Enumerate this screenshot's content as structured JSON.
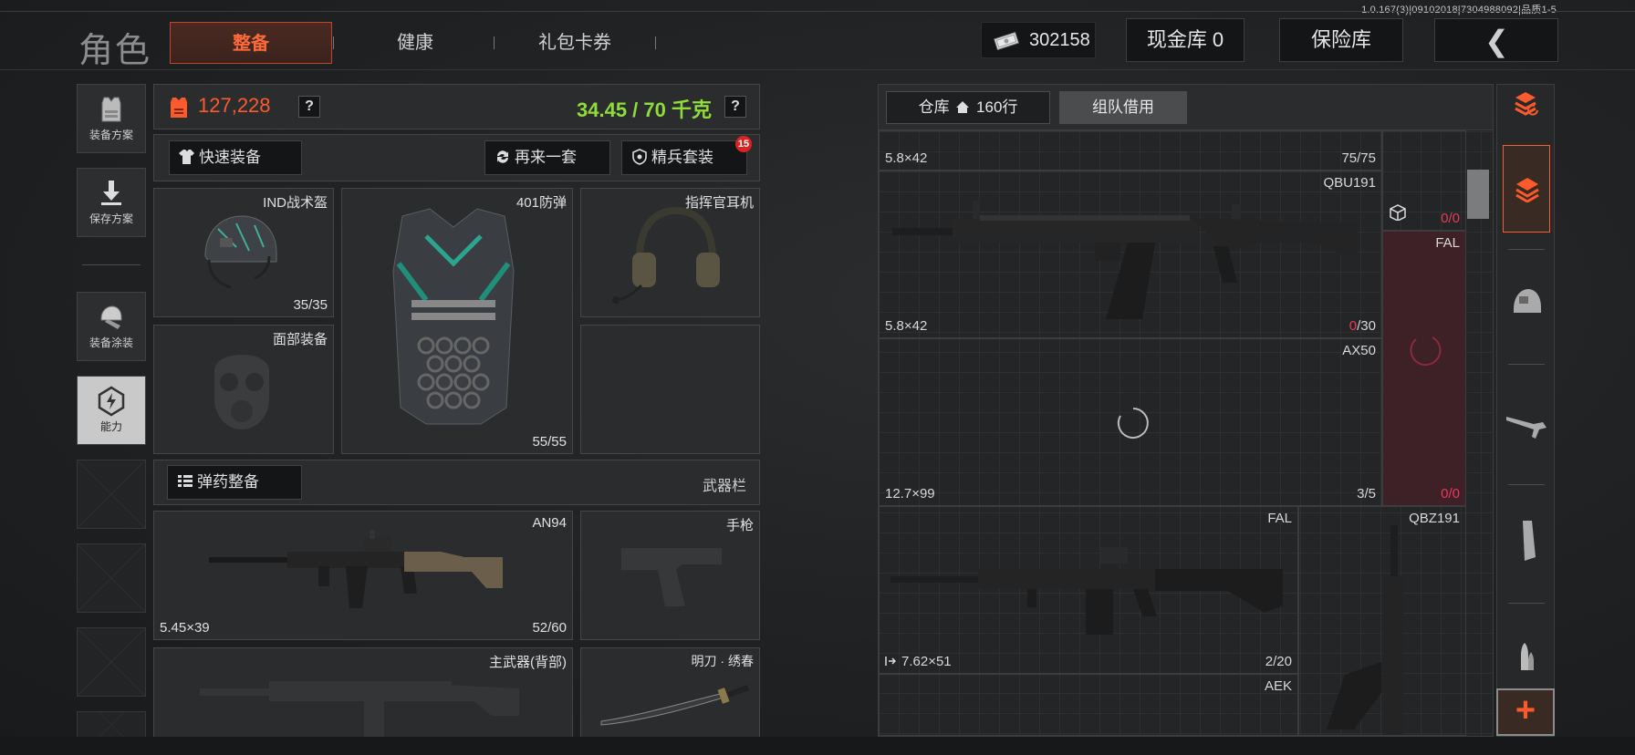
{
  "version_text": "1.0.167(3)|09102018|7304988092|品质1-5",
  "header": {
    "title": "角色",
    "tabs": [
      {
        "label": "整备",
        "active": true
      },
      {
        "label": "健康",
        "active": false
      },
      {
        "label": "礼包卡券",
        "active": false
      }
    ],
    "money_value": "302158",
    "cash_vault_label": "现金库 0",
    "safe_label": "保险库",
    "back_icon": "chevron-left-icon"
  },
  "left_nav": {
    "items": [
      {
        "label": "装备方案",
        "icon": "vest-plan-icon"
      },
      {
        "label": "保存方案",
        "icon": "download-icon"
      },
      {
        "label": "装备涂装",
        "icon": "helmet-paint-icon"
      },
      {
        "label": "能力",
        "icon": "ability-icon",
        "selected": true
      }
    ]
  },
  "loadout": {
    "price": "127,228",
    "weight": "34.45 / 70 千克",
    "help_label": "?",
    "quick_equip_label": "快速装备",
    "again_label": "再来一套",
    "elite_label": "精兵套装",
    "elite_badge": "15",
    "slots": {
      "helmet": {
        "name": "IND战术盔",
        "count": "35/35"
      },
      "armor": {
        "name": "401防弹",
        "count": "55/55"
      },
      "headset": {
        "name": "指挥官耳机"
      },
      "face": {
        "name": "面部装备"
      }
    },
    "ammo_label": "弹药整备",
    "weapon_bar_label": "武器栏",
    "primary": {
      "name": "AN94",
      "caliber": "5.45×39",
      "count": "52/60"
    },
    "pistol": {
      "name": "手枪"
    },
    "back_weapon": {
      "name": "主武器(背部)"
    },
    "melee": {
      "name": "明刀 · 绣春"
    }
  },
  "warehouse": {
    "tab_storage_label": "仓库",
    "tab_storage_rows": "160行",
    "tab_team_label": "组队借用",
    "items": [
      {
        "caliber": "5.8×42",
        "count": "75/75"
      },
      {
        "name": "QBU191",
        "caliber": "5.8×42",
        "count_red": "0",
        "count_rest": "/30"
      },
      {
        "name": "AX50",
        "caliber": "12.7×99",
        "count": "3/5"
      },
      {
        "name": "FAL",
        "caliber": "7.62×51",
        "count": "2/20"
      },
      {
        "name": "QBZ191"
      },
      {
        "name": "AEK"
      },
      {
        "name": "FAL",
        "count_red": "0",
        "count_rest": "/0"
      },
      {
        "count_red": "0",
        "count_rest": "/0"
      }
    ]
  },
  "right_bar": {
    "icons": [
      "sort-icon",
      "stack-icon",
      "helmet-icon",
      "rifle-icon",
      "magazine-icon",
      "ammo-icon"
    ],
    "add_label": "+"
  },
  "colors": {
    "accent": "#ff5a2c",
    "weight": "#8fdc3a",
    "alert": "#e83a5a"
  }
}
